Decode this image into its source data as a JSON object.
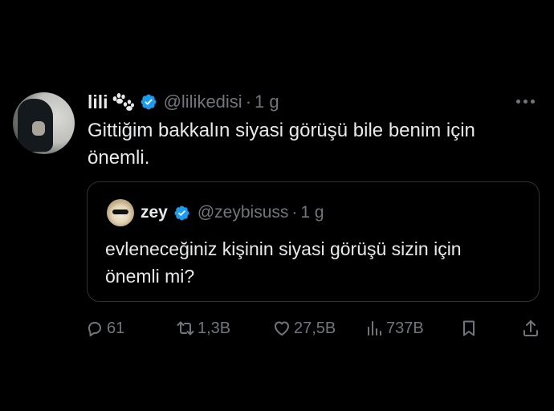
{
  "tweet": {
    "author": {
      "name": "lili",
      "handle": "@lilikedisi",
      "time": "1 g",
      "separator": "·",
      "verified_color": "#1d9bf0"
    },
    "text": "Gittiğim bakkalın siyasi görüşü bile benim için\nönemli.",
    "quoted": {
      "name": "zey",
      "handle": "@zeybisuss",
      "time": "1 g",
      "separator": "·",
      "text": "evleneceğiniz kişinin siyasi görüşü sizin için\nönemli mi?"
    },
    "metrics": {
      "replies": "61",
      "reposts": "1,3B",
      "likes": "27,5B",
      "views": "737B"
    }
  },
  "icons": {
    "author_badge": "paw-prints-icon",
    "verified": "verified-badge-icon",
    "more": "more-options-icon",
    "reply": "reply-icon",
    "repost": "repost-icon",
    "like": "heart-icon",
    "views": "views-chart-icon",
    "bookmark": "bookmark-icon",
    "share": "share-icon"
  },
  "colors": {
    "background": "#000000",
    "text": "#e7e9ea",
    "secondary": "#71767b",
    "border": "#2f3336",
    "accent": "#1d9bf0"
  }
}
